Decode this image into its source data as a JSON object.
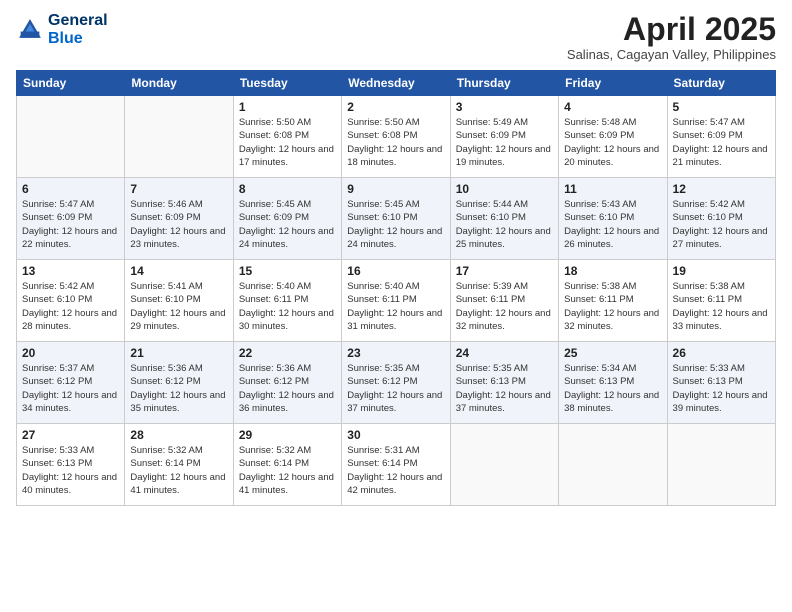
{
  "header": {
    "logo_line1": "General",
    "logo_line2": "Blue",
    "month_title": "April 2025",
    "location": "Salinas, Cagayan Valley, Philippines"
  },
  "weekdays": [
    "Sunday",
    "Monday",
    "Tuesday",
    "Wednesday",
    "Thursday",
    "Friday",
    "Saturday"
  ],
  "weeks": [
    [
      {
        "day": "",
        "sunrise": "",
        "sunset": "",
        "daylight": ""
      },
      {
        "day": "",
        "sunrise": "",
        "sunset": "",
        "daylight": ""
      },
      {
        "day": "1",
        "sunrise": "Sunrise: 5:50 AM",
        "sunset": "Sunset: 6:08 PM",
        "daylight": "Daylight: 12 hours and 17 minutes."
      },
      {
        "day": "2",
        "sunrise": "Sunrise: 5:50 AM",
        "sunset": "Sunset: 6:08 PM",
        "daylight": "Daylight: 12 hours and 18 minutes."
      },
      {
        "day": "3",
        "sunrise": "Sunrise: 5:49 AM",
        "sunset": "Sunset: 6:09 PM",
        "daylight": "Daylight: 12 hours and 19 minutes."
      },
      {
        "day": "4",
        "sunrise": "Sunrise: 5:48 AM",
        "sunset": "Sunset: 6:09 PM",
        "daylight": "Daylight: 12 hours and 20 minutes."
      },
      {
        "day": "5",
        "sunrise": "Sunrise: 5:47 AM",
        "sunset": "Sunset: 6:09 PM",
        "daylight": "Daylight: 12 hours and 21 minutes."
      }
    ],
    [
      {
        "day": "6",
        "sunrise": "Sunrise: 5:47 AM",
        "sunset": "Sunset: 6:09 PM",
        "daylight": "Daylight: 12 hours and 22 minutes."
      },
      {
        "day": "7",
        "sunrise": "Sunrise: 5:46 AM",
        "sunset": "Sunset: 6:09 PM",
        "daylight": "Daylight: 12 hours and 23 minutes."
      },
      {
        "day": "8",
        "sunrise": "Sunrise: 5:45 AM",
        "sunset": "Sunset: 6:09 PM",
        "daylight": "Daylight: 12 hours and 24 minutes."
      },
      {
        "day": "9",
        "sunrise": "Sunrise: 5:45 AM",
        "sunset": "Sunset: 6:10 PM",
        "daylight": "Daylight: 12 hours and 24 minutes."
      },
      {
        "day": "10",
        "sunrise": "Sunrise: 5:44 AM",
        "sunset": "Sunset: 6:10 PM",
        "daylight": "Daylight: 12 hours and 25 minutes."
      },
      {
        "day": "11",
        "sunrise": "Sunrise: 5:43 AM",
        "sunset": "Sunset: 6:10 PM",
        "daylight": "Daylight: 12 hours and 26 minutes."
      },
      {
        "day": "12",
        "sunrise": "Sunrise: 5:42 AM",
        "sunset": "Sunset: 6:10 PM",
        "daylight": "Daylight: 12 hours and 27 minutes."
      }
    ],
    [
      {
        "day": "13",
        "sunrise": "Sunrise: 5:42 AM",
        "sunset": "Sunset: 6:10 PM",
        "daylight": "Daylight: 12 hours and 28 minutes."
      },
      {
        "day": "14",
        "sunrise": "Sunrise: 5:41 AM",
        "sunset": "Sunset: 6:10 PM",
        "daylight": "Daylight: 12 hours and 29 minutes."
      },
      {
        "day": "15",
        "sunrise": "Sunrise: 5:40 AM",
        "sunset": "Sunset: 6:11 PM",
        "daylight": "Daylight: 12 hours and 30 minutes."
      },
      {
        "day": "16",
        "sunrise": "Sunrise: 5:40 AM",
        "sunset": "Sunset: 6:11 PM",
        "daylight": "Daylight: 12 hours and 31 minutes."
      },
      {
        "day": "17",
        "sunrise": "Sunrise: 5:39 AM",
        "sunset": "Sunset: 6:11 PM",
        "daylight": "Daylight: 12 hours and 32 minutes."
      },
      {
        "day": "18",
        "sunrise": "Sunrise: 5:38 AM",
        "sunset": "Sunset: 6:11 PM",
        "daylight": "Daylight: 12 hours and 32 minutes."
      },
      {
        "day": "19",
        "sunrise": "Sunrise: 5:38 AM",
        "sunset": "Sunset: 6:11 PM",
        "daylight": "Daylight: 12 hours and 33 minutes."
      }
    ],
    [
      {
        "day": "20",
        "sunrise": "Sunrise: 5:37 AM",
        "sunset": "Sunset: 6:12 PM",
        "daylight": "Daylight: 12 hours and 34 minutes."
      },
      {
        "day": "21",
        "sunrise": "Sunrise: 5:36 AM",
        "sunset": "Sunset: 6:12 PM",
        "daylight": "Daylight: 12 hours and 35 minutes."
      },
      {
        "day": "22",
        "sunrise": "Sunrise: 5:36 AM",
        "sunset": "Sunset: 6:12 PM",
        "daylight": "Daylight: 12 hours and 36 minutes."
      },
      {
        "day": "23",
        "sunrise": "Sunrise: 5:35 AM",
        "sunset": "Sunset: 6:12 PM",
        "daylight": "Daylight: 12 hours and 37 minutes."
      },
      {
        "day": "24",
        "sunrise": "Sunrise: 5:35 AM",
        "sunset": "Sunset: 6:13 PM",
        "daylight": "Daylight: 12 hours and 37 minutes."
      },
      {
        "day": "25",
        "sunrise": "Sunrise: 5:34 AM",
        "sunset": "Sunset: 6:13 PM",
        "daylight": "Daylight: 12 hours and 38 minutes."
      },
      {
        "day": "26",
        "sunrise": "Sunrise: 5:33 AM",
        "sunset": "Sunset: 6:13 PM",
        "daylight": "Daylight: 12 hours and 39 minutes."
      }
    ],
    [
      {
        "day": "27",
        "sunrise": "Sunrise: 5:33 AM",
        "sunset": "Sunset: 6:13 PM",
        "daylight": "Daylight: 12 hours and 40 minutes."
      },
      {
        "day": "28",
        "sunrise": "Sunrise: 5:32 AM",
        "sunset": "Sunset: 6:14 PM",
        "daylight": "Daylight: 12 hours and 41 minutes."
      },
      {
        "day": "29",
        "sunrise": "Sunrise: 5:32 AM",
        "sunset": "Sunset: 6:14 PM",
        "daylight": "Daylight: 12 hours and 41 minutes."
      },
      {
        "day": "30",
        "sunrise": "Sunrise: 5:31 AM",
        "sunset": "Sunset: 6:14 PM",
        "daylight": "Daylight: 12 hours and 42 minutes."
      },
      {
        "day": "",
        "sunrise": "",
        "sunset": "",
        "daylight": ""
      },
      {
        "day": "",
        "sunrise": "",
        "sunset": "",
        "daylight": ""
      },
      {
        "day": "",
        "sunrise": "",
        "sunset": "",
        "daylight": ""
      }
    ]
  ]
}
